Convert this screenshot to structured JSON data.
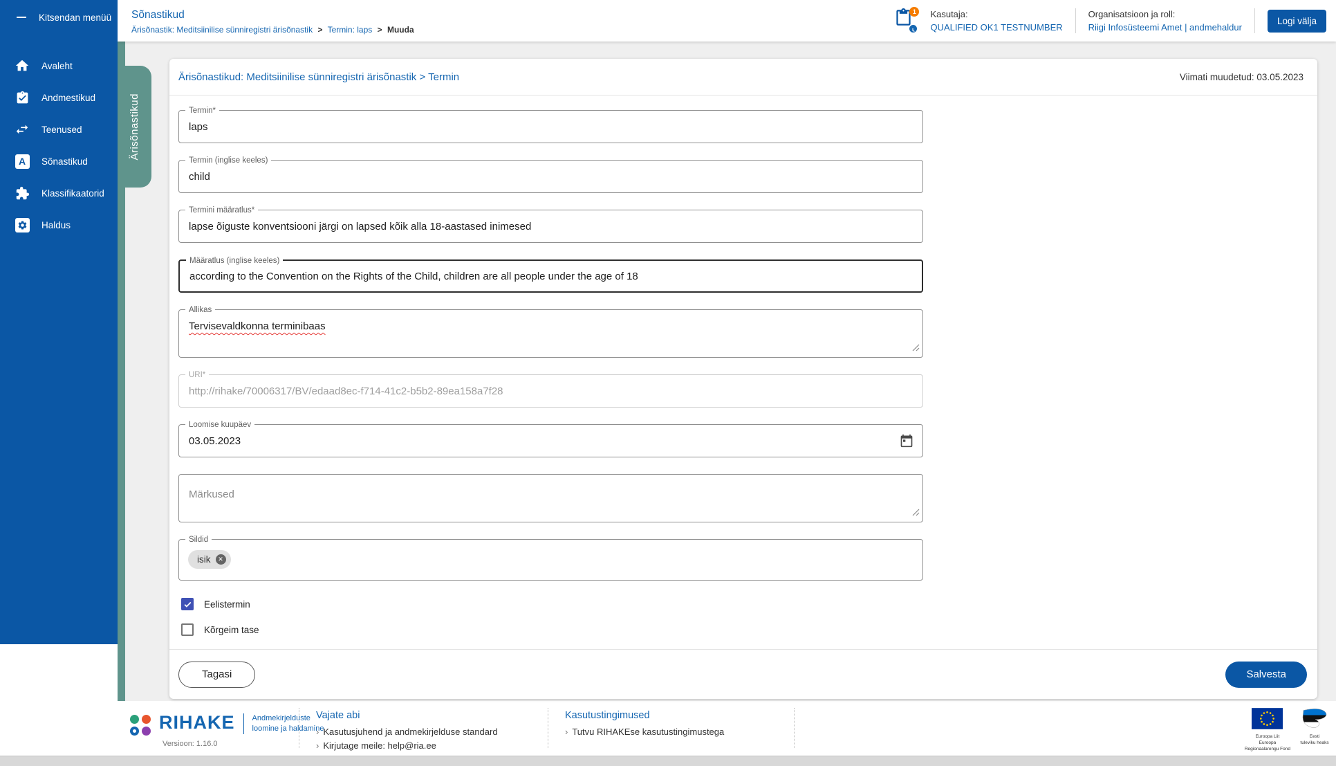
{
  "colors": {
    "primary_blue": "#0b57a5",
    "link_blue": "#1566b1",
    "tab_green": "#5f948c",
    "checkbox_indigo": "#3f51b5",
    "badge_orange": "#f57c00"
  },
  "sidebar": {
    "collapse_label": "Kitsendan menüü",
    "items": [
      {
        "label": "Avaleht",
        "icon": "home-icon"
      },
      {
        "label": "Andmestikud",
        "icon": "clipboard-check-icon"
      },
      {
        "label": "Teenused",
        "icon": "swap-arrows-icon"
      },
      {
        "label": "Sõnastikud",
        "icon": "letter-a-icon"
      },
      {
        "label": "Klassifikaatorid",
        "icon": "puzzle-icon"
      },
      {
        "label": "Haldus",
        "icon": "gear-icon"
      }
    ]
  },
  "side_tab": {
    "label": "Ärisõnastikud"
  },
  "header": {
    "title": "Sõnastikud",
    "breadcrumb": {
      "link1": "Ärisõnastik: Meditsiinilise sünniregistri ärisõnastik",
      "sep1": ">",
      "link2": "Termin: laps",
      "sep2": ">",
      "current": "Muuda"
    },
    "notification_badge": "1",
    "user_label": "Kasutaja:",
    "user_name": "QUALIFIED OK1 TESTNUMBER",
    "org_label": "Organisatsioon ja roll:",
    "org_value": "Riigi Infosüsteemi Amet | andmehaldur",
    "logout_label": "Logi välja"
  },
  "form": {
    "title": "Ärisõnastikud: Meditsiinilise sünniregistri ärisõnastik > Termin",
    "last_modified": "Viimati muudetud: 03.05.2023",
    "fields": {
      "termin": {
        "label": "Termin*",
        "value": "laps"
      },
      "termin_en": {
        "label": "Termin (inglise keeles)",
        "value": "child"
      },
      "definition": {
        "label": "Termini määratlus*",
        "value": "lapse õiguste konventsiooni järgi on lapsed kõik alla 18-aastased inimesed"
      },
      "definition_en": {
        "label": "Määratlus (inglise keeles)",
        "value": "according to the Convention on the Rights of the Child, children are all people under the age of 18"
      },
      "source": {
        "label": "Allikas",
        "value": "Tervisevaldkonna terminibaas"
      },
      "uri": {
        "label": "URI*",
        "value": "http://rihake/70006317/BV/edaad8ec-f714-41c2-b5b2-89ea158a7f28"
      },
      "created": {
        "label": "Loomise kuupäev",
        "value": "03.05.2023"
      },
      "notes": {
        "placeholder": "Märkused"
      },
      "tags": {
        "label": "Sildid",
        "chips": [
          {
            "label": "isik"
          }
        ]
      }
    },
    "checkboxes": [
      {
        "label": "Eelistermin",
        "checked": true
      },
      {
        "label": "Kõrgeim tase",
        "checked": false
      }
    ],
    "back_label": "Tagasi",
    "save_label": "Salvesta"
  },
  "footer": {
    "brand": {
      "name": "RIHAKE",
      "tagline_line1": "Andmekirjelduste",
      "tagline_line2": "loomine ja haldamine",
      "version": "Versioon: 1.16.0"
    },
    "help": {
      "heading": "Vajate abi",
      "links": [
        "Kasutusjuhend ja andmekirjelduse standard",
        "Kirjutage meile: help@ria.ee"
      ]
    },
    "terms": {
      "heading": "Kasutustingimused",
      "links": [
        "Tutvu RIHAKEse kasutustingimustega"
      ]
    },
    "eu_logo": {
      "line1": "Euroopa Liit",
      "line2": "Euroopa",
      "line3": "Regionaalarengu Fond"
    },
    "est_logo": {
      "line1": "Eesti",
      "line2": "tuleviku heaks"
    }
  }
}
